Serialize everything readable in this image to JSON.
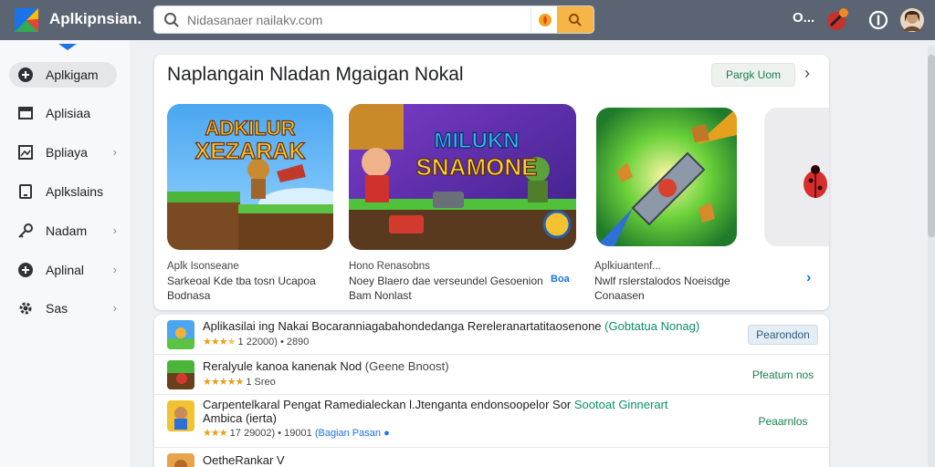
{
  "app": {
    "title": "Aplkipnsian."
  },
  "search": {
    "placeholder": "Nidasanaer nailakv.com",
    "value": ""
  },
  "top_bar": {
    "status": "O..."
  },
  "sidebar": {
    "items": [
      {
        "label": "Aplkigam",
        "icon": "gamepad-icon",
        "active": true,
        "chevron": false
      },
      {
        "label": "Aplisiaa",
        "icon": "inbox-icon",
        "active": false,
        "chevron": false
      },
      {
        "label": "Bpliaya",
        "icon": "image-icon",
        "active": false,
        "chevron": true
      },
      {
        "label": "Aplkslains",
        "icon": "tablet-icon",
        "active": false,
        "chevron": false
      },
      {
        "label": "Nadam",
        "icon": "key-icon",
        "active": false,
        "chevron": true
      },
      {
        "label": "Aplinal",
        "icon": "plus-circle-icon",
        "active": false,
        "chevron": true
      },
      {
        "label": "Sas",
        "icon": "gear-icon",
        "active": false,
        "chevron": true
      }
    ]
  },
  "featured": {
    "title": "Naplangain Nladan Mgaigan Nokal",
    "button_label": "Pargk Uom",
    "games": [
      {
        "art_text": [
          "ADKILUR",
          "XEZARAK"
        ],
        "category": "Aplk Isonseane",
        "line1": "Sarkeoal Kde tba tosn Ucapoa",
        "line2": "Bodnasa"
      },
      {
        "art_text": [
          "MILUKN",
          "SNAMONE"
        ],
        "category": "Hono Renasobns",
        "line1": "Noey Blaero dae verseundel Gesoenion",
        "line2": "Bam Nonlast",
        "side_badge": "Boa"
      },
      {
        "art_text": [],
        "category": "Aplkiuantenf...",
        "line1": "Nwlf rslerstalodos Noeisdge",
        "line2": "Conaasen"
      }
    ]
  },
  "list": {
    "rows": [
      {
        "title": "Aplikasilai ing Nakai Bocaranniagabahondedanga Rereleranartatitaosenone",
        "tag": "(Gobtatua Nonag)",
        "rating_text": "1 22000) • 2890",
        "stars": 3,
        "verified": "",
        "action": "Pearondon",
        "action_filled": true
      },
      {
        "title": "Reralyule kanoa kanenak Nod",
        "tag": "(Geene Bnoost)",
        "rating_text": "1 Sreo",
        "stars": 5,
        "verified": "",
        "action": "Pfeatum nos",
        "action_filled": false
      },
      {
        "title": "Carpentelkaral Pengat Ramedialeckan l.Jtenganta endonsoopelor Sor",
        "title2": "Ambica (ierta)",
        "tag": "Sootoat Ginnerart",
        "rating_text": "17 29002) • 19001",
        "stars": 3,
        "verified": "(Bagian Pasan",
        "action": "Peaarnlos",
        "action_filled": false
      },
      {
        "title": "OetheRankar V",
        "tag": "",
        "rating_text": "",
        "stars": 0,
        "verified": "",
        "action": "",
        "action_filled": false
      }
    ]
  },
  "colors": {
    "topbar": "#5b6472",
    "accent_blue": "#1a73e8",
    "accent_green": "#18804e",
    "search_button": "#f6b546"
  }
}
